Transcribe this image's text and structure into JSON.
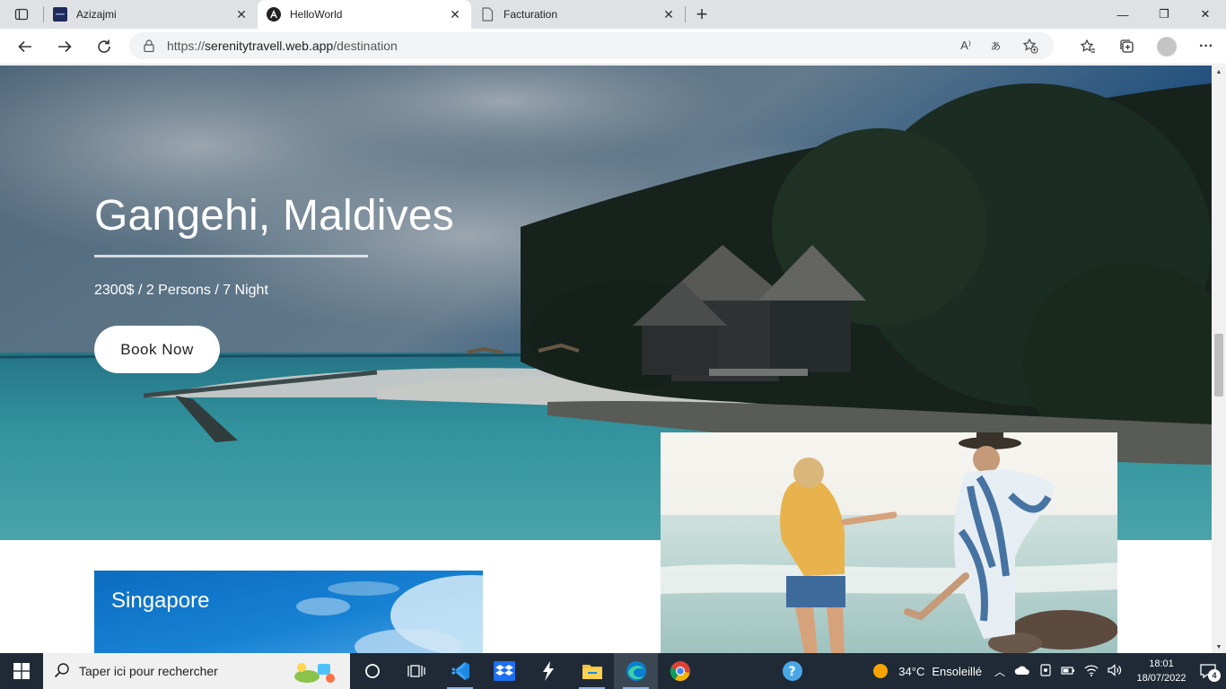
{
  "browser": {
    "tabs": [
      {
        "title": "Azizajmi",
        "icon": "site-favicon-icon",
        "active": false
      },
      {
        "title": "HelloWorld",
        "icon": "angular-icon",
        "active": true
      },
      {
        "title": "Facturation",
        "icon": "page-icon",
        "active": false
      }
    ],
    "close_glyph": "✕",
    "new_tab_glyph": "+",
    "window_controls": {
      "minimize": "—",
      "restore": "❐",
      "close": "✕"
    },
    "url_prefix": "https://",
    "url_host": "serenitytravell.web.app",
    "url_path": "/destination",
    "read_aloud": "A⁾",
    "more_glyph": "···"
  },
  "page": {
    "hero": {
      "title": "Gangehi, Maldives",
      "subtitle": "2300$ / 2 Persons / 7 Night",
      "cta_label": "Book Now"
    },
    "cards": [
      {
        "label": "Singapore"
      }
    ]
  },
  "taskbar": {
    "search_placeholder": "Taper ici pour rechercher",
    "weather_temp": "34°C",
    "weather_text": "Ensoleillé",
    "time": "18:01",
    "date": "18/07/2022",
    "notification_count": "4"
  },
  "colors": {
    "taskbar_bg": "#1f2a36",
    "tabbar_bg": "#dfe1e5",
    "sea": "#3fb6c2",
    "sky": "#1e5f9e"
  }
}
